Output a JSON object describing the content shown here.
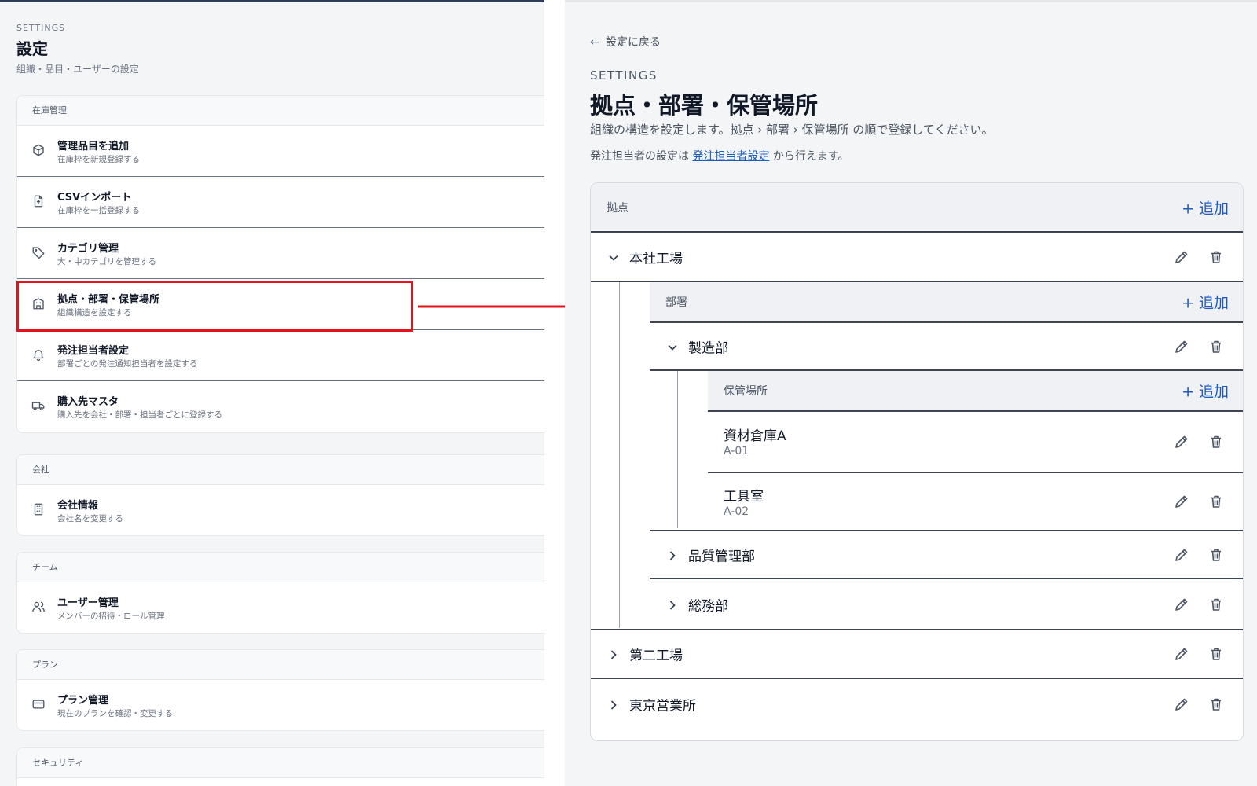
{
  "left": {
    "eyebrow": "SETTINGS",
    "title": "設定",
    "subtitle": "組織・品目・ユーザーの設定",
    "groups": [
      {
        "label": "在庫管理",
        "items": [
          {
            "label": "管理品目を追加",
            "desc": "在庫枠を新規登録する",
            "icon": "box-icon"
          },
          {
            "label": "CSVインポート",
            "desc": "在庫枠を一括登録する",
            "icon": "file-upload-icon"
          },
          {
            "label": "カテゴリ管理",
            "desc": "大・中カテゴリを管理する",
            "icon": "tag-icon"
          },
          {
            "label": "拠点・部署・保管場所",
            "desc": "組織構造を設定する",
            "icon": "building-icon"
          },
          {
            "label": "発注担当者設定",
            "desc": "部署ごとの発注通知担当者を設定する",
            "icon": "bell-icon"
          },
          {
            "label": "購入先マスタ",
            "desc": "購入先を会社・部署・担当者ごとに登録する",
            "icon": "truck-icon"
          }
        ]
      },
      {
        "label": "会社",
        "items": [
          {
            "label": "会社情報",
            "desc": "会社名を変更する",
            "icon": "office-icon"
          }
        ]
      },
      {
        "label": "チーム",
        "items": [
          {
            "label": "ユーザー管理",
            "desc": "メンバーの招待・ロール管理",
            "icon": "users-icon"
          }
        ]
      },
      {
        "label": "プラン",
        "items": [
          {
            "label": "プラン管理",
            "desc": "現在のプランを確認・変更する",
            "icon": "card-icon"
          }
        ]
      },
      {
        "label": "セキュリティ",
        "items": []
      }
    ],
    "highlight_color": "#e3121b"
  },
  "right": {
    "back_label": "設定に戻る",
    "eyebrow": "SETTINGS",
    "title": "拠点・部署・保管場所",
    "description": "組織の構造を設定します。拠点 › 部署 › 保管場所 の順で登録してください。",
    "note_prefix": "発注担当者の設定は ",
    "note_link": "発注担当者設定",
    "note_suffix": " から行えます。",
    "add_label": "追加",
    "sections": {
      "bases": "拠点",
      "departments": "部署",
      "locations": "保管場所"
    },
    "bases": [
      {
        "name": "本社工場",
        "expanded": true
      },
      {
        "name": "第二工場",
        "expanded": false
      },
      {
        "name": "東京営業所",
        "expanded": false
      }
    ],
    "departments": [
      {
        "name": "製造部",
        "expanded": true
      },
      {
        "name": "品質管理部",
        "expanded": false
      },
      {
        "name": "総務部",
        "expanded": false
      }
    ],
    "locations": [
      {
        "name": "資材倉庫A",
        "code": "A-01"
      },
      {
        "name": "工具室",
        "code": "A-02"
      }
    ],
    "accent_color": "#1d5bbf"
  }
}
